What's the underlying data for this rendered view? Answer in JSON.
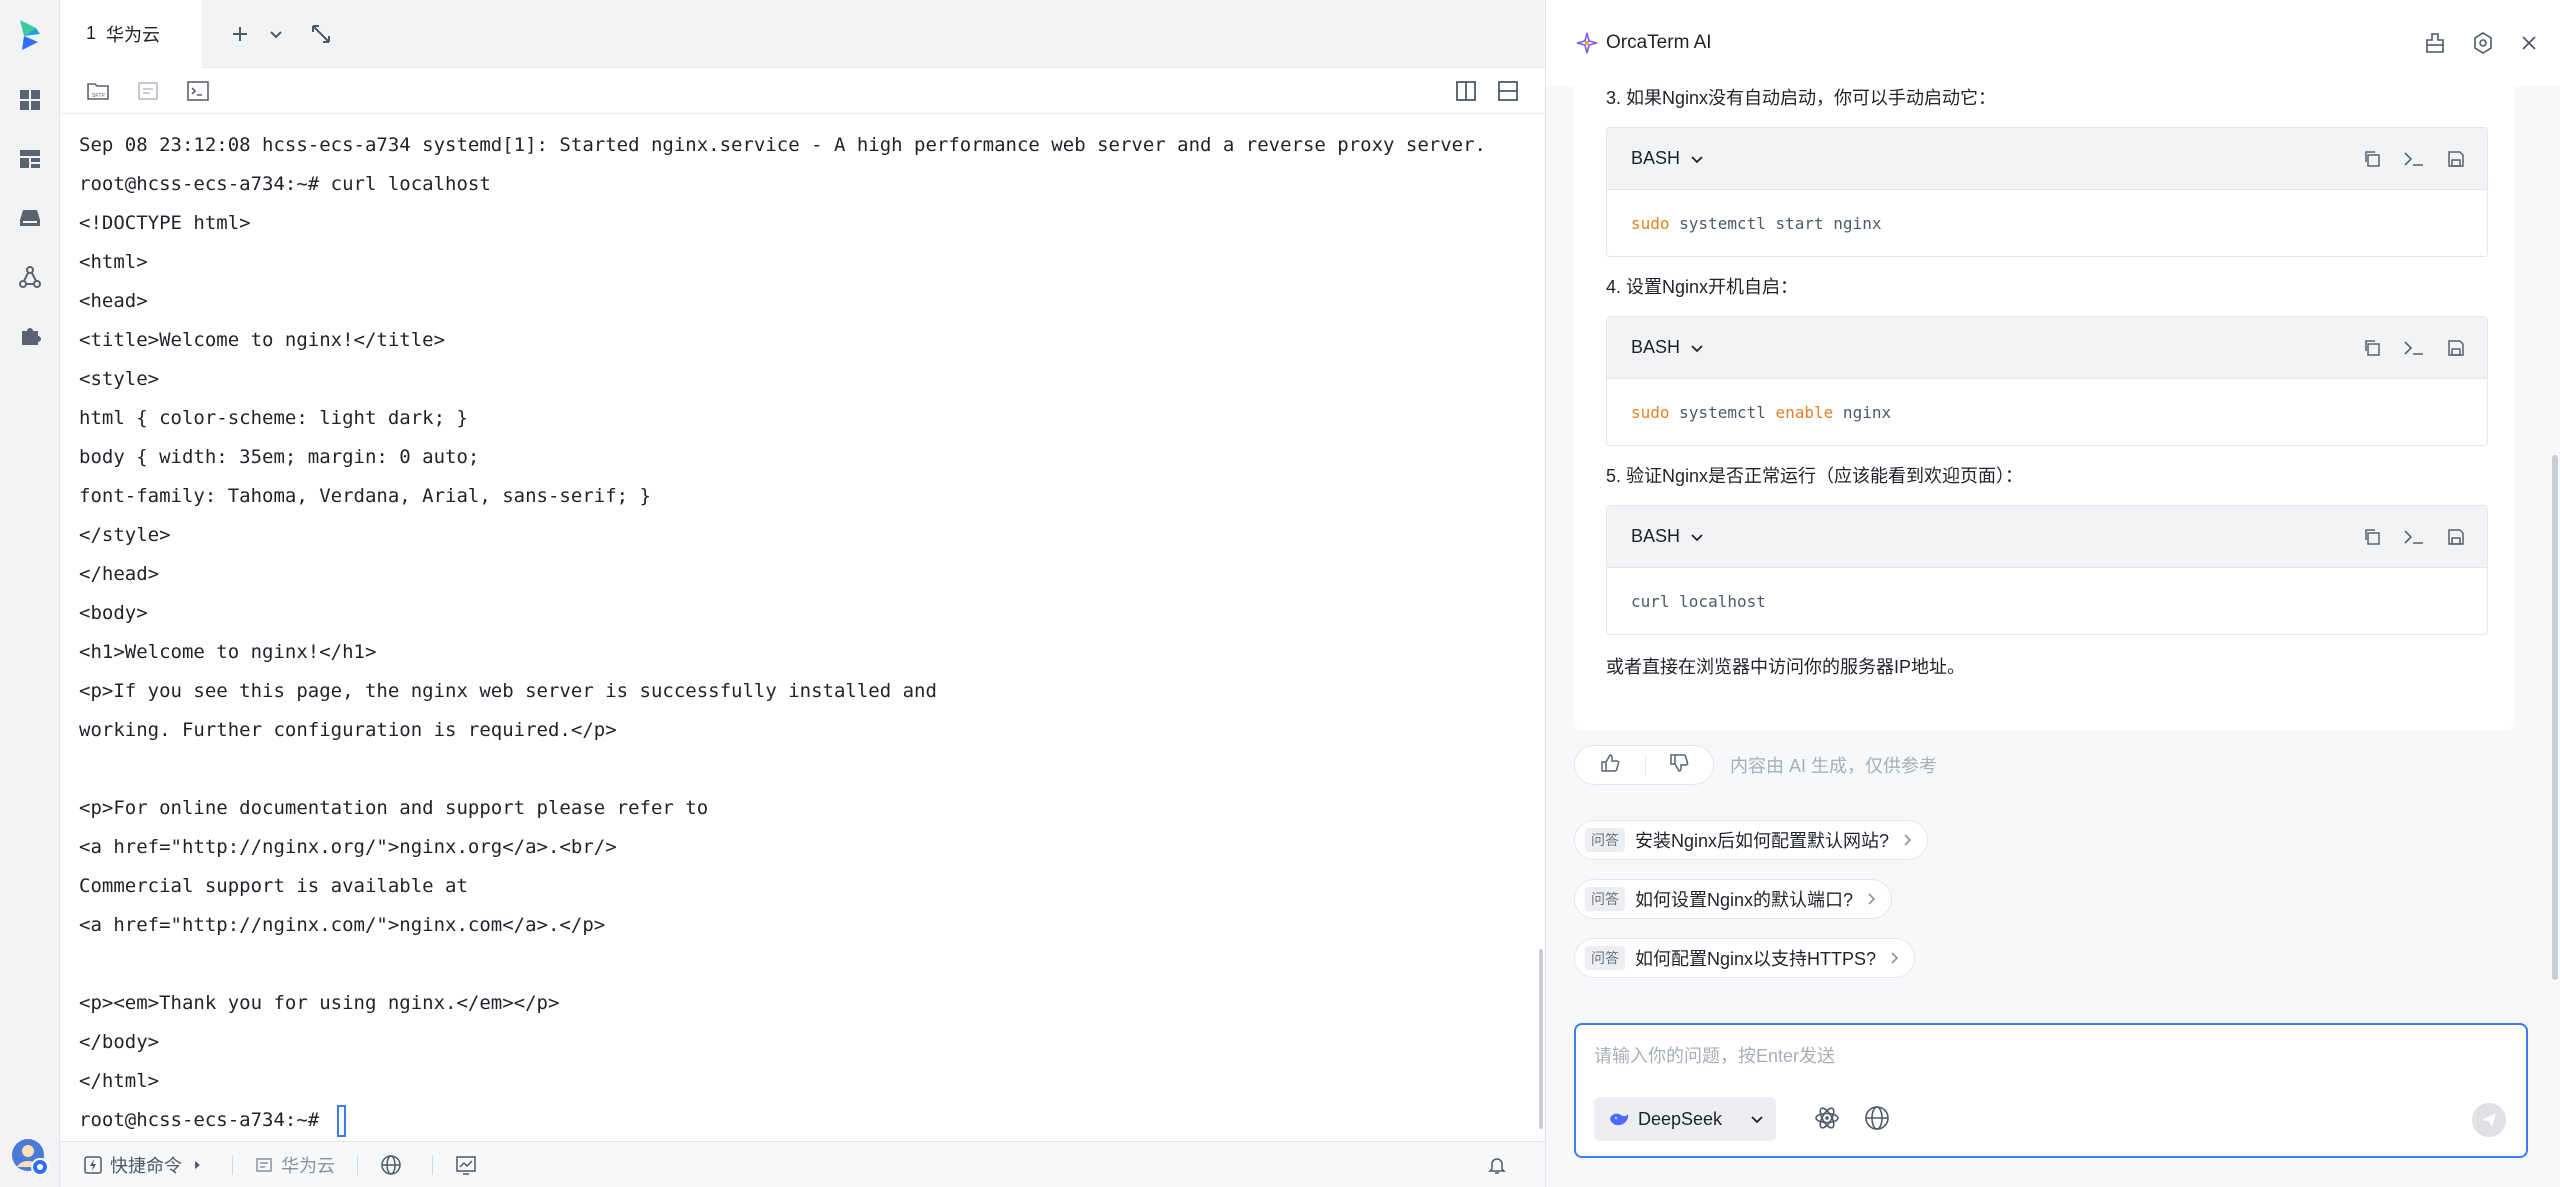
{
  "tabs": [
    {
      "number": "1",
      "label": "华为云"
    }
  ],
  "terminal": {
    "lines": [
      "Sep 08 23:12:08 hcss-ecs-a734 systemd[1]: Started nginx.service - A high performance web server and a reverse proxy server.",
      "root@hcss-ecs-a734:~# curl localhost",
      "<!DOCTYPE html>",
      "<html>",
      "<head>",
      "<title>Welcome to nginx!</title>",
      "<style>",
      "html { color-scheme: light dark; }",
      "body { width: 35em; margin: 0 auto;",
      "font-family: Tahoma, Verdana, Arial, sans-serif; }",
      "</style>",
      "</head>",
      "<body>",
      "<h1>Welcome to nginx!</h1>",
      "<p>If you see this page, the nginx web server is successfully installed and",
      "working. Further configuration is required.</p>",
      "",
      "<p>For online documentation and support please refer to",
      "<a href=\"http://nginx.org/\">nginx.org</a>.<br/>",
      "Commercial support is available at",
      "<a href=\"http://nginx.com/\">nginx.com</a>.</p>",
      "",
      "<p><em>Thank you for using nginx.</em></p>",
      "</body>",
      "</html>"
    ],
    "prompt": "root@hcss-ecs-a734:~# "
  },
  "statusbar": {
    "quick_commands": "快捷命令",
    "host": "华为云"
  },
  "ai": {
    "title": "OrcaTerm AI",
    "steps": [
      {
        "text": "3. 如果Nginx没有自动启动，你可以手动启动它：",
        "lang": "BASH",
        "code": [
          {
            "t": "sudo",
            "kw": true
          },
          {
            "t": " systemctl start nginx",
            "kw": false
          }
        ]
      },
      {
        "text": "4. 设置Nginx开机自启：",
        "lang": "BASH",
        "code": [
          {
            "t": "sudo",
            "kw": true
          },
          {
            "t": " systemctl ",
            "kw": false
          },
          {
            "t": "enable",
            "kw": true
          },
          {
            "t": " nginx",
            "kw": false
          }
        ]
      },
      {
        "text": "5. 验证Nginx是否正常运行（应该能看到欢迎页面）：",
        "lang": "BASH",
        "code": [
          {
            "t": "curl localhost",
            "kw": false
          }
        ]
      }
    ],
    "closing": "或者直接在浏览器中访问你的服务器IP地址。",
    "disclaimer": "内容由 AI 生成，仅供参考",
    "suggestions": [
      {
        "tag": "问答",
        "text": "安装Nginx后如何配置默认网站?"
      },
      {
        "tag": "问答",
        "text": "如何设置Nginx的默认端口?"
      },
      {
        "tag": "问答",
        "text": "如何配置Nginx以支持HTTPS?"
      }
    ],
    "input_placeholder": "请输入你的问题，按Enter发送",
    "model": "DeepSeek"
  },
  "colors": {
    "accent": "#3c7bf5",
    "keyword": "#e67e22"
  }
}
